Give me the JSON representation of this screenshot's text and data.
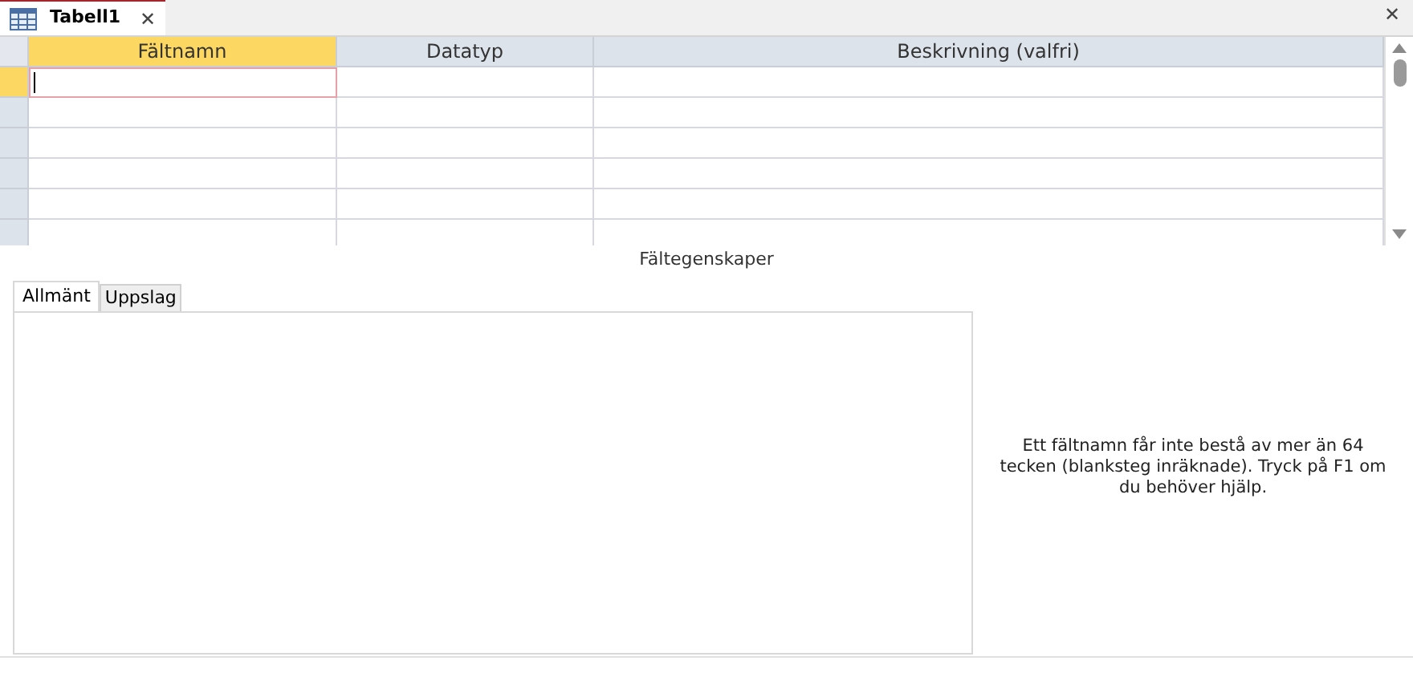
{
  "document_tab": {
    "title": "Tabell1",
    "close": "✕"
  },
  "window_close": "✕",
  "grid": {
    "columns": [
      {
        "label": "Fältnamn",
        "selected": true
      },
      {
        "label": "Datatyp",
        "selected": false
      },
      {
        "label": "Beskrivning (valfri)",
        "selected": false
      }
    ],
    "rows": [
      {
        "selected": true
      },
      {
        "selected": false
      },
      {
        "selected": false
      },
      {
        "selected": false
      },
      {
        "selected": false
      },
      {
        "selected": false
      }
    ]
  },
  "properties": {
    "title": "Fältegenskaper",
    "tabs": [
      {
        "label": "Allmänt",
        "selected": true
      },
      {
        "label": "Uppslag",
        "selected": false
      }
    ],
    "help": "Ett fältnamn får inte bestå av mer än 64 tecken (blanksteg inräknade). Tryck på F1 om du behöver hjälp."
  }
}
